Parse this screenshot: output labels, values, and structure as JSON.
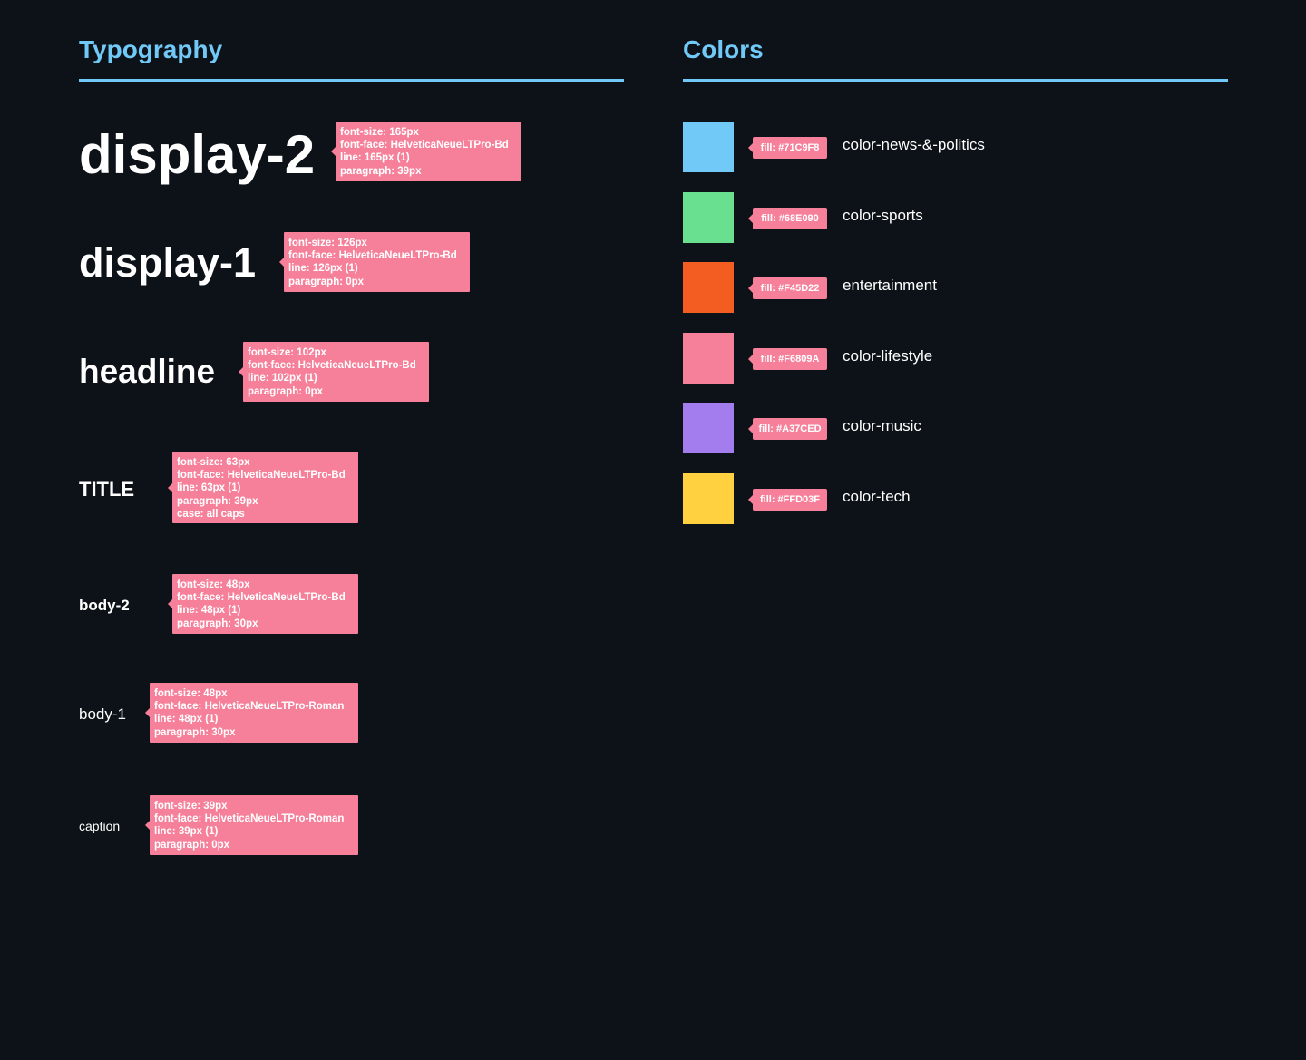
{
  "typography": {
    "title": "Typography",
    "items": [
      {
        "sample": "display-2",
        "spec": [
          "font-size: 165px",
          "font-face: HelveticaNeueLTPro-Bd",
          "line: 165px (1)",
          "paragraph: 39px"
        ]
      },
      {
        "sample": "display-1",
        "spec": [
          "font-size: 126px",
          "font-face: HelveticaNeueLTPro-Bd",
          "line: 126px (1)",
          "paragraph: 0px"
        ]
      },
      {
        "sample": "headline",
        "spec": [
          "font-size: 102px",
          "font-face: HelveticaNeueLTPro-Bd",
          "line: 102px (1)",
          "paragraph: 0px"
        ]
      },
      {
        "sample": "TITLE",
        "spec": [
          "font-size: 63px",
          "font-face: HelveticaNeueLTPro-Bd",
          "line: 63px (1)",
          "paragraph: 39px",
          "case: all caps"
        ]
      },
      {
        "sample": "body-2",
        "spec": [
          "font-size: 48px",
          "font-face: HelveticaNeueLTPro-Bd",
          "line: 48px (1)",
          "paragraph: 30px"
        ]
      },
      {
        "sample": "body-1",
        "spec": [
          "font-size: 48px",
          "font-face: HelveticaNeueLTPro-Roman",
          "line: 48px (1)",
          "paragraph: 30px"
        ]
      },
      {
        "sample": "caption",
        "spec": [
          "font-size: 39px",
          "font-face: HelveticaNeueLTPro-Roman",
          "line: 39px (1)",
          "paragraph: 0px"
        ]
      }
    ]
  },
  "colors": {
    "title": "Colors",
    "items": [
      {
        "fill_label": "fill: #71C9F8",
        "hex": "#71C9F8",
        "name": "color-news-&-politics"
      },
      {
        "fill_label": "fill: #68E090",
        "hex": "#68E090",
        "name": "color-sports"
      },
      {
        "fill_label": "fill: #F45D22",
        "hex": "#F45D22",
        "name": "entertainment"
      },
      {
        "fill_label": "fill: #F6809A",
        "hex": "#F6809A",
        "name": "color-lifestyle"
      },
      {
        "fill_label": "fill: #A37CED",
        "hex": "#A37CED",
        "name": "color-music"
      },
      {
        "fill_label": "fill: #FFD03F",
        "hex": "#FFD03F",
        "name": "color-tech"
      }
    ]
  },
  "theme": {
    "background": "#0c1217",
    "accent": "#71c9f8",
    "tag": "#f6809a"
  }
}
